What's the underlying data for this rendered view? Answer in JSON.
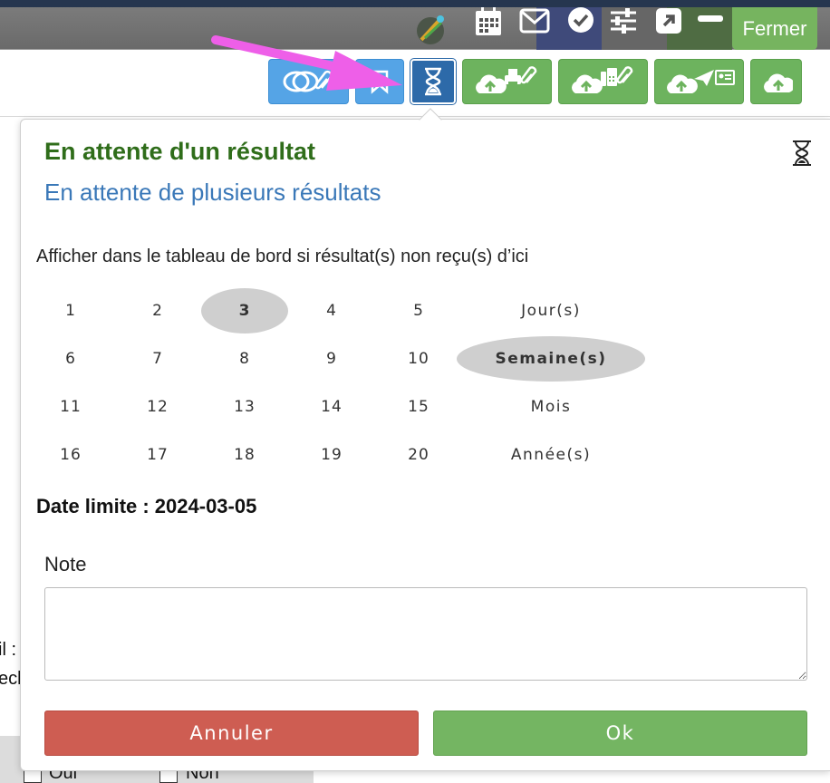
{
  "header": {
    "close_label": "Fermer",
    "icons": [
      "meeting-icon",
      "calendar-icon",
      "envelope-icon",
      "check-circle-icon",
      "sliders-icon",
      "external-link-icon",
      "minus-icon"
    ]
  },
  "toolbar": {
    "buttons": [
      "toggle-attach-button",
      "bookmark-button",
      "hourglass-button",
      "upload-print-attach-button",
      "upload-fax-attach-button",
      "upload-send-card-button",
      "upload-button"
    ]
  },
  "background": {
    "label_fragment_1": "il :",
    "label_fragment_2": "ecl",
    "checkbox_yes": "Oui",
    "checkbox_no": "Non"
  },
  "popup": {
    "title": "En attente d'un résultat",
    "subtitle": "En attente de plusieurs résultats",
    "instruction": "Afficher dans le tableau de bord si résultat(s) non reçu(s) d’ici",
    "numbers": [
      "1",
      "2",
      "3",
      "4",
      "5",
      "6",
      "7",
      "8",
      "9",
      "10",
      "11",
      "12",
      "13",
      "14",
      "15",
      "16",
      "17",
      "18",
      "19",
      "20"
    ],
    "units": [
      "Jour(s)",
      "Semaine(s)",
      "Mois",
      "Année(s)"
    ],
    "selected_number": "3",
    "selected_unit": "Semaine(s)",
    "deadline_label": "Date limite : 2024-03-05",
    "note_label": "Note",
    "note_value": "",
    "cancel_label": "Annuler",
    "ok_label": "Ok"
  },
  "colors": {
    "title_green": "#2f6d1a",
    "subtitle_blue": "#3a78b8",
    "cancel_red": "#ce5d52",
    "ok_green": "#74b562",
    "arrow_magenta": "#ee5fe8"
  }
}
